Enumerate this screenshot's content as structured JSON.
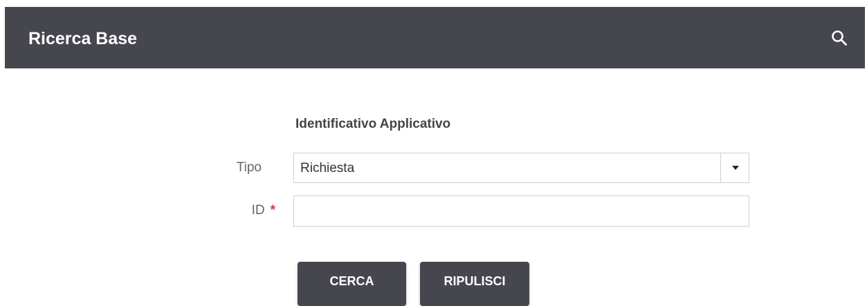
{
  "header": {
    "title": "Ricerca Base",
    "search_icon": "search-icon"
  },
  "form": {
    "section_title": "Identificativo Applicativo",
    "tipo": {
      "label": "Tipo",
      "selected_value": "Richiesta"
    },
    "id": {
      "label": "ID",
      "required_marker": "*",
      "value": "",
      "placeholder": ""
    }
  },
  "actions": {
    "search_label": "CERCA",
    "clear_label": "RIPULISCI"
  },
  "colors": {
    "header_bg": "#46464f",
    "button_bg": "#46464f",
    "required": "#e0303a"
  }
}
